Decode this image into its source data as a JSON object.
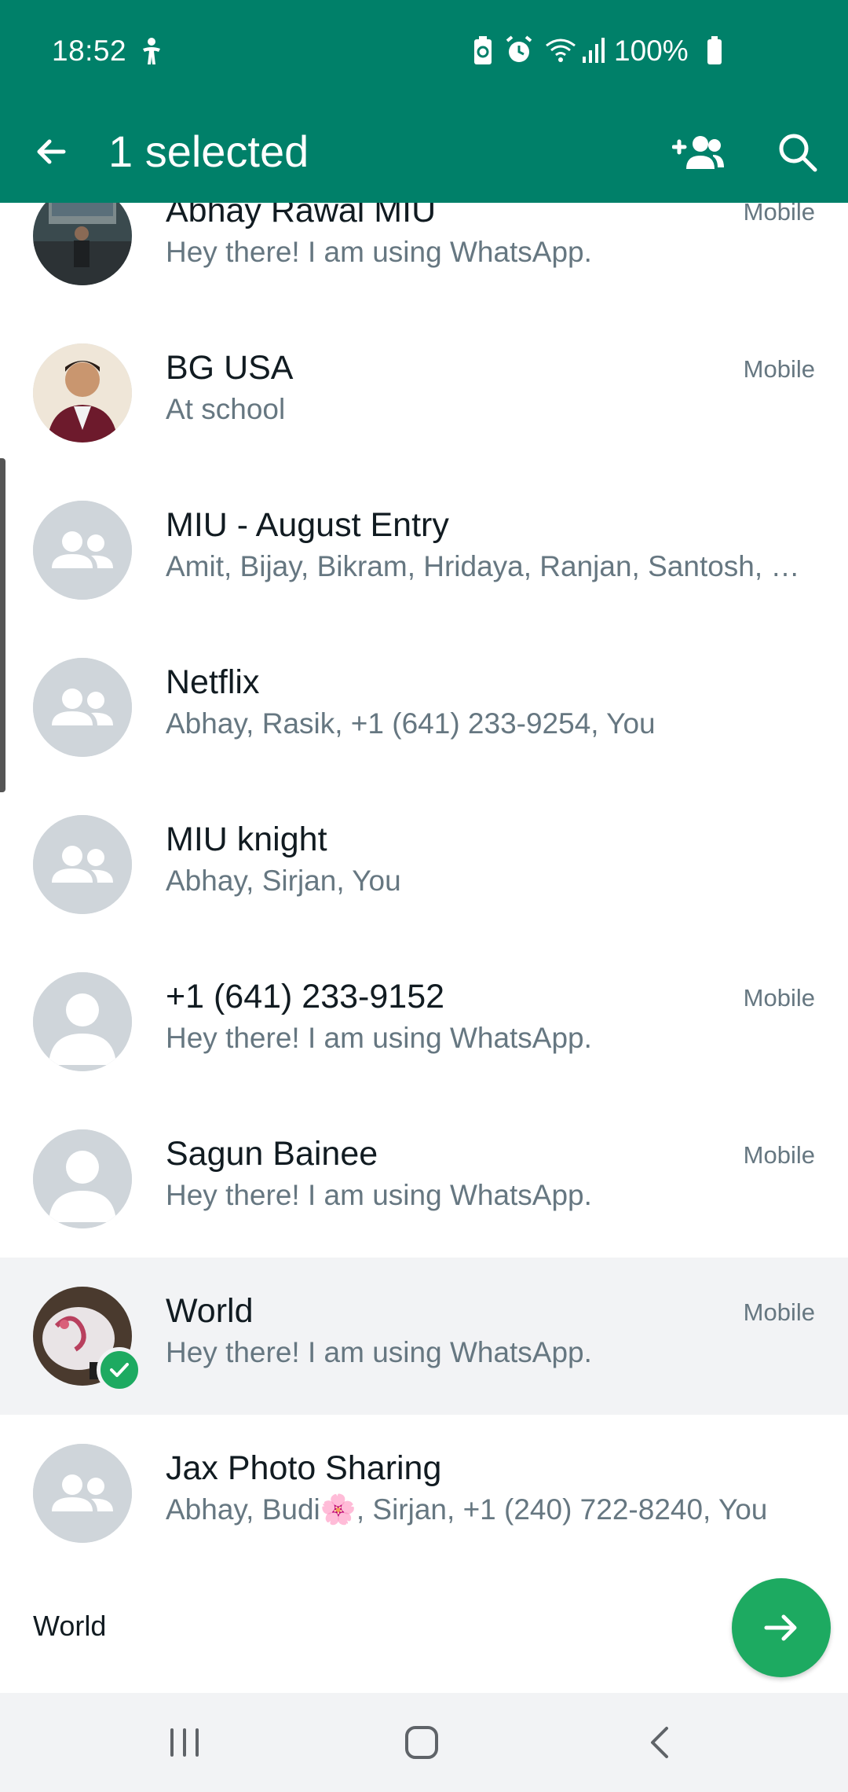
{
  "status_bar": {
    "time": "18:52",
    "battery_text": "100%"
  },
  "toolbar": {
    "title": "1 selected"
  },
  "contacts": [
    {
      "name": "Abhay Rawal MIU",
      "status": "Hey there! I am using WhatsApp.",
      "type": "Mobile",
      "avatar": "photo",
      "selected": false
    },
    {
      "name": "BG USA",
      "status": "At school",
      "type": "Mobile",
      "avatar": "photo",
      "selected": false
    },
    {
      "name": "MIU - August Entry",
      "status": "Amit, Bijay, Bikram, Hridaya, Ranjan, Santosh, …",
      "type": "",
      "avatar": "group-icon",
      "selected": false
    },
    {
      "name": "Netflix",
      "status": "Abhay, Rasik, +1 (641) 233-9254, You",
      "type": "",
      "avatar": "group-icon",
      "selected": false
    },
    {
      "name": "MIU knight",
      "status": "Abhay, Sirjan, You",
      "type": "",
      "avatar": "group-icon",
      "selected": false
    },
    {
      "name": "+1 (641) 233-9152",
      "status": "Hey there! I am using WhatsApp.",
      "type": "Mobile",
      "avatar": "person-icon",
      "selected": false
    },
    {
      "name": "Sagun Bainee",
      "status": "Hey there! I am using WhatsApp.",
      "type": "Mobile",
      "avatar": "person-icon",
      "selected": false
    },
    {
      "name": "World",
      "status": "Hey there! I am using WhatsApp.",
      "type": "Mobile",
      "avatar": "photo",
      "selected": true
    },
    {
      "name": "Jax Photo Sharing",
      "status": "Abhay, Budi🌸, Sirjan, +1 (240) 722-8240, You",
      "type": "",
      "avatar": "group-icon",
      "selected": false
    }
  ],
  "selection_bar": {
    "label": "World"
  },
  "colors": {
    "header": "#008069",
    "accent": "#1daa61",
    "text_primary": "#111b21",
    "text_secondary": "#667781",
    "selected_row": "#f2f3f5"
  }
}
